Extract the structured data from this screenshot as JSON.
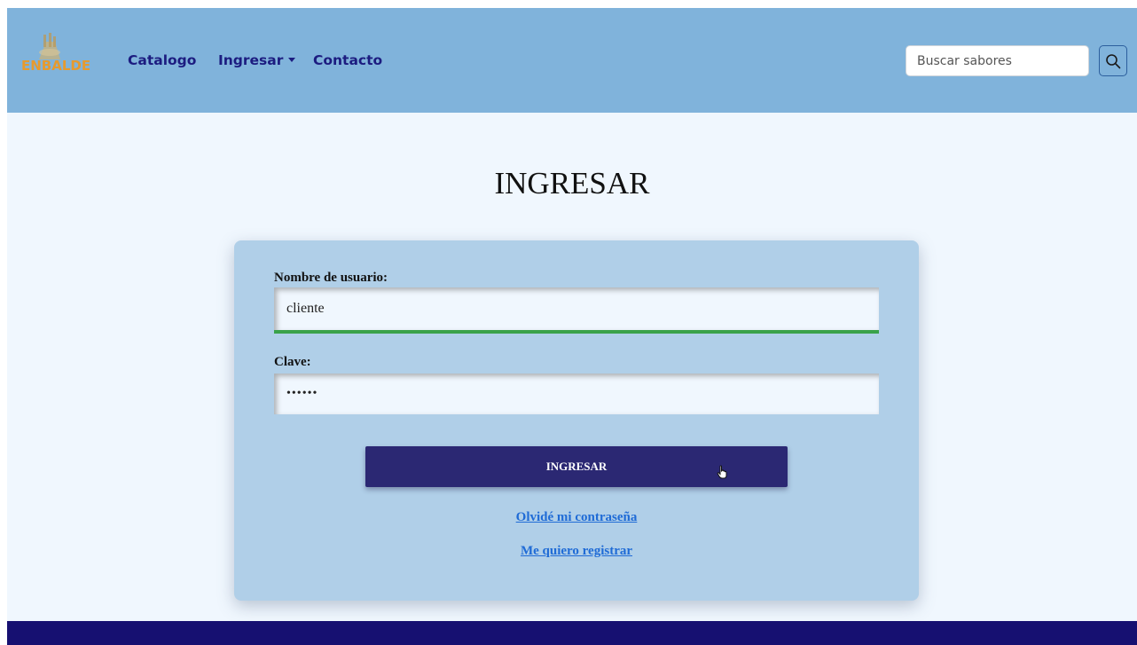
{
  "navbar": {
    "logo_text": "ENBALDE",
    "links": {
      "catalogo": "Catalogo",
      "ingresar": "Ingresar",
      "contacto": "Contacto"
    },
    "search": {
      "placeholder": "Buscar sabores"
    }
  },
  "login": {
    "title": "INGRESAR",
    "username_label": "Nombre de usuario:",
    "username_value": "cliente",
    "password_label": "Clave:",
    "password_value": "••••••",
    "submit_label": "INGRESAR",
    "forgot_link": "Olvidé mi contraseña",
    "register_link": "Me quiero registrar"
  },
  "colors": {
    "navbar_bg": "#80b3db",
    "page_bg": "#f0f7fe",
    "card_bg": "#b0cfe8",
    "nav_text": "#1c1c80",
    "button_bg": "#2b2873",
    "link": "#1f6bd6",
    "valid_border": "#3aa24a",
    "footer_bg": "#161071",
    "logo": "#e69a2e"
  },
  "icons": {
    "search": "search-icon",
    "logo": "ice-cream-bucket-icon",
    "cursor": "hand-pointer-icon",
    "dropdown": "caret-down-icon"
  }
}
